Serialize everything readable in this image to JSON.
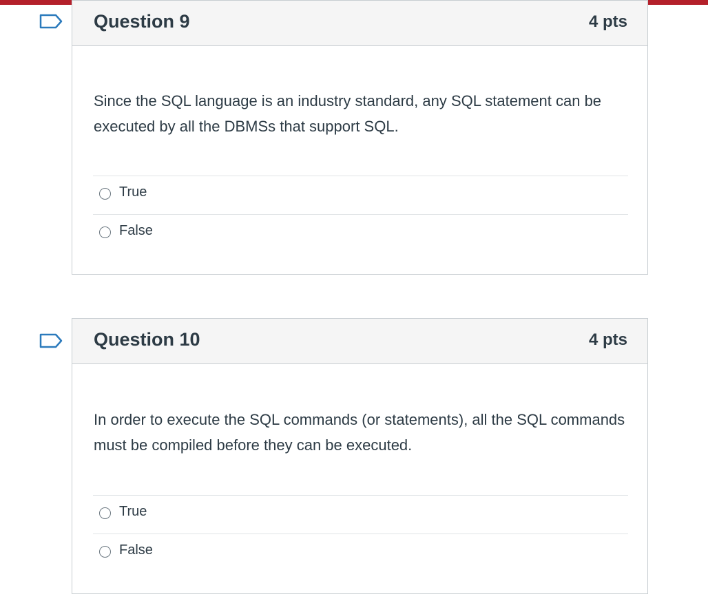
{
  "colors": {
    "accent_bar": "#b4202a",
    "flag_outline": "#2b7abc",
    "header_bg": "#f5f5f5",
    "border": "#c7cdd1"
  },
  "questions": [
    {
      "title": "Question 9",
      "points": "4 pts",
      "text": "Since the SQL language is an industry standard, any SQL statement can be executed by all the DBMSs that support SQL.",
      "answers": [
        "True",
        "False"
      ],
      "flag_icon": "flag-question-icon"
    },
    {
      "title": "Question 10",
      "points": "4 pts",
      "text": "In order to execute the SQL commands (or statements), all the SQL commands must be compiled before they can be executed.",
      "answers": [
        "True",
        "False"
      ],
      "flag_icon": "flag-question-icon"
    }
  ]
}
